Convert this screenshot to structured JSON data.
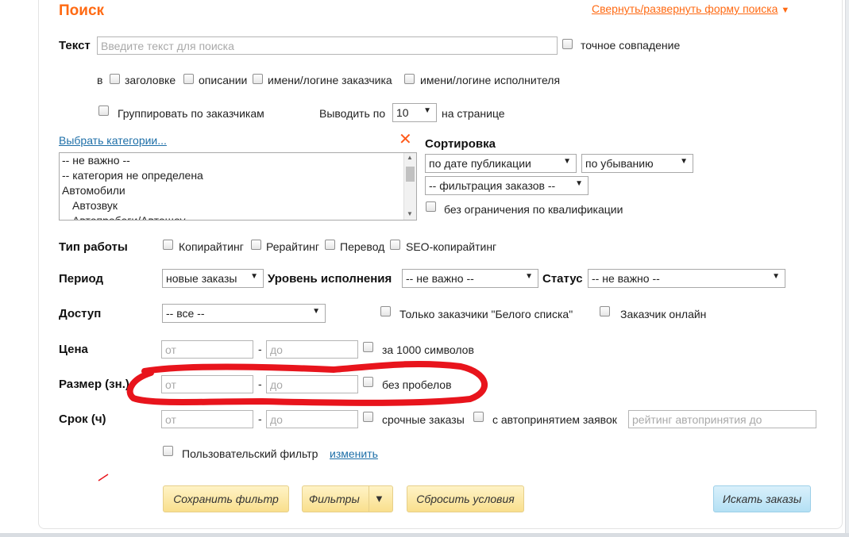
{
  "title": "Поиск",
  "toggle_link": "Свернуть/развернуть форму поиска",
  "text_search": {
    "label": "Текст",
    "placeholder": "Введите текст для поиска",
    "exact_match": "точное совпадение",
    "in_label": "в",
    "in_title": "заголовке",
    "in_description": "описании",
    "in_customer": "имени/логине заказчика",
    "in_performer": "имени/логине исполнителя"
  },
  "grouping": {
    "group_by_customer": "Группировать по заказчикам",
    "per_page_label": "Выводить по",
    "per_page_value": "10",
    "per_page_suffix": "на странице"
  },
  "categories": {
    "link": "Выбрать категории...",
    "clear_icon": "close-icon",
    "options": [
      {
        "label": "-- не важно --",
        "sub": false
      },
      {
        "label": "-- категория не определена",
        "sub": false
      },
      {
        "label": "Автомобили",
        "sub": false
      },
      {
        "label": "Автозвук",
        "sub": true
      },
      {
        "label": "Автопробеги/Автошоу",
        "sub": true
      }
    ]
  },
  "sorting": {
    "label": "Сортировка",
    "by": "по дате публикации",
    "order": "по убыванию",
    "filter": "-- фильтрация заказов --",
    "no_qualification_limit": "без ограничения по квалификации"
  },
  "work_type": {
    "label": "Тип работы",
    "copywriting": "Копирайтинг",
    "rewriting": "Рерайтинг",
    "translation": "Перевод",
    "seo": "SEO-копирайтинг"
  },
  "period": {
    "label": "Период",
    "value": "новые заказы",
    "level_label": "Уровень исполнения",
    "level_value": "-- не важно --",
    "status_label": "Статус",
    "status_value": "-- не важно --"
  },
  "access": {
    "label": "Доступ",
    "value": "-- все --",
    "whitelist_only": "Только заказчики \"Белого списка\"",
    "customer_online": "Заказчик онлайн"
  },
  "price": {
    "label": "Цена",
    "from_placeholder": "от",
    "dash": "-",
    "to_placeholder": "до",
    "per_1000": "за 1000 символов"
  },
  "size": {
    "label": "Размер (зн.)",
    "from_placeholder": "от",
    "dash": "-",
    "to_placeholder": "до",
    "no_spaces": "без пробелов"
  },
  "deadline": {
    "label": "Срок (ч)",
    "from_placeholder": "от",
    "dash": "-",
    "to_placeholder": "до",
    "urgent": "срочные заказы",
    "auto_accept": "с автопринятием заявок",
    "auto_accept_placeholder": "рейтинг автопринятия до"
  },
  "custom_filter": {
    "label": "Пользовательский фильтр",
    "edit_link": "изменить"
  },
  "buttons": {
    "save_filter": "Сохранить фильтр",
    "filters": "Фильтры",
    "reset": "Сбросить условия",
    "search": "Искать заказы"
  },
  "colors": {
    "accent": "#ff6a13",
    "link": "#1e6fa8",
    "annotation": "#e8141c"
  }
}
